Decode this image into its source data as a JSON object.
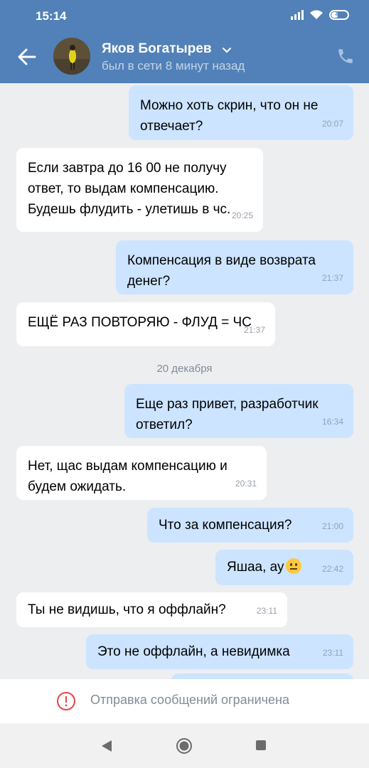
{
  "status_bar": {
    "time": "15:14",
    "battery": "47"
  },
  "header": {
    "contact_name": "Яков Богатырев",
    "contact_status": "был в сети 8 минут назад"
  },
  "messages": [
    {
      "dir": "out",
      "text": "Можно хоть скрин, что он не\nотвечает?",
      "time": "20:07"
    },
    {
      "dir": "in",
      "text": "Если завтра до 16 00 не получу\nответ, то выдам компенсацию.\nБудешь флудить - улетишь в чс.",
      "time": "20:25"
    },
    {
      "dir": "out",
      "text": "Компенсация в виде возврата\nденег?",
      "time": "21:37"
    },
    {
      "dir": "in",
      "text": "ЕЩЁ РАЗ ПОВТОРЯЮ - ФЛУД = ЧС",
      "time": "21:37"
    },
    {
      "dir": "out",
      "text": "Еще раз привет, разработчик\nответил?",
      "time": "16:34"
    },
    {
      "dir": "in",
      "text": "Нет, щас выдам компенсацию и\nбудем ожидать.",
      "time": "20:31"
    },
    {
      "dir": "out",
      "text": "Что за компенсация?",
      "time": "21:00"
    },
    {
      "dir": "out",
      "text": "Яшаа, ау",
      "time": "22:42",
      "emoji": "neutral-face"
    },
    {
      "dir": "in",
      "text": "Ты не видишь, что я оффлайн?",
      "time": "23:11"
    },
    {
      "dir": "out",
      "text": "Это не оффлайн, а невидимка",
      "time": "23:11"
    }
  ],
  "date_separator": "20 декабря",
  "restriction": {
    "text": "Отправка сообщений ограничена"
  },
  "colors": {
    "header": "#5181b8",
    "outgoing": "#cce4ff",
    "incoming": "#ffffff",
    "background": "#edeef0"
  }
}
